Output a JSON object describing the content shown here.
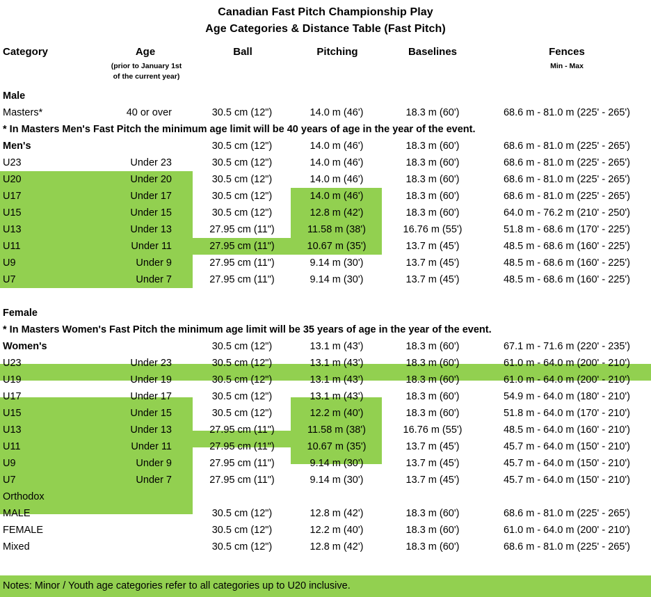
{
  "title": {
    "line1": "Canadian Fast Pitch Championship Play",
    "line2": "Age Categories & Distance Table (Fast Pitch)"
  },
  "headers": {
    "category": "Category",
    "age": "Age",
    "age_sub1": "(prior  to January 1st",
    "age_sub2": "of the current year)",
    "ball": "Ball",
    "pitching": "Pitching",
    "baselines": "Baselines",
    "fences": "Fences",
    "fences_sub": "Min - Max"
  },
  "colors": {
    "highlight": "#92D050",
    "text": "#000000",
    "background": "#FFFFFF"
  },
  "sections": {
    "male_label": "Male",
    "male_note": "* In Masters Men's Fast Pitch the minimum age limit will be 40 years of age in the year of the event.",
    "female_label": "Female",
    "female_note": "* In Masters Women's Fast Pitch the minimum age limit will be 35 years of age in the year of the event.",
    "orthodox_label": "Orthodox"
  },
  "male_rows": [
    {
      "category": "Masters*",
      "age": "40 or over",
      "ball": "30.5 cm (12\")",
      "pitching": "14.0 m (46')",
      "baselines": "18.3 m (60')",
      "fences": "68.6 m - 81.0 m (225' - 265')",
      "bold": false
    },
    {
      "category": "Men's",
      "age": "",
      "ball": "30.5 cm (12\")",
      "pitching": "14.0 m (46')",
      "baselines": "18.3 m (60')",
      "fences": "68.6 m - 81.0 m (225' - 265')",
      "bold": true
    },
    {
      "category": "U23",
      "age": "Under 23",
      "ball": "30.5 cm (12\")",
      "pitching": "14.0 m (46')",
      "baselines": "18.3 m (60')",
      "fences": "68.6 m - 81.0 m (225' - 265')",
      "bold": false
    },
    {
      "category": "U20",
      "age": "Under 20",
      "ball": "30.5 cm (12\")",
      "pitching": "14.0 m (46')",
      "baselines": "18.3 m (60')",
      "fences": "68.6 m - 81.0 m (225' - 265')",
      "bold": false
    },
    {
      "category": "U17",
      "age": "Under 17",
      "ball": "30.5 cm (12\")",
      "pitching": "14.0 m (46')",
      "baselines": "18.3 m (60')",
      "fences": "68.6 m - 81.0 m (225' - 265')",
      "bold": false
    },
    {
      "category": "U15",
      "age": "Under 15",
      "ball": "30.5 cm (12\")",
      "pitching": "12.8 m (42')",
      "baselines": "18.3 m (60')",
      "fences": "64.0 m - 76.2 m (210' - 250')",
      "bold": false
    },
    {
      "category": "U13",
      "age": "Under 13",
      "ball": "27.95 cm (11\")",
      "pitching": "11.58 m (38')",
      "baselines": "16.76 m (55')",
      "fences": "51.8 m - 68.6 m (170' - 225')",
      "bold": false
    },
    {
      "category": "U11",
      "age": "Under 11",
      "ball": "27.95 cm (11\")",
      "pitching": "10.67 m (35')",
      "baselines": "13.7 m (45')",
      "fences": "48.5 m - 68.6 m (160' - 225')",
      "bold": false
    },
    {
      "category": "U9",
      "age": "Under 9",
      "ball": "27.95 cm (11\")",
      "pitching": "9.14 m (30')",
      "baselines": "13.7 m (45')",
      "fences": "48.5 m - 68.6 m (160' - 225')",
      "bold": false
    },
    {
      "category": "U7",
      "age": "Under 7",
      "ball": "27.95 cm (11\")",
      "pitching": "9.14 m (30')",
      "baselines": "13.7 m (45')",
      "fences": "48.5 m - 68.6 m (160' - 225')",
      "bold": false
    }
  ],
  "female_rows": [
    {
      "category": "Women's",
      "age": "",
      "ball": "30.5 cm (12\")",
      "pitching": "13.1 m (43')",
      "baselines": "18.3 m (60')",
      "fences": "67.1 m - 71.6 m (220' - 235')",
      "bold": true
    },
    {
      "category": "U23",
      "age": "Under 23",
      "ball": "30.5 cm (12\")",
      "pitching": "13.1 m (43')",
      "baselines": "18.3 m (60')",
      "fences": "61.0 m - 64.0 m (200' - 210')",
      "bold": false
    },
    {
      "category": "U19",
      "age": "Under 19",
      "ball": "30.5 cm (12\")",
      "pitching": "13.1 m (43')",
      "baselines": "18.3 m (60')",
      "fences": "61.0 m - 64.0 m (200' - 210')",
      "bold": false
    },
    {
      "category": "U17",
      "age": "Under 17",
      "ball": "30.5 cm (12\")",
      "pitching": "13.1 m (43')",
      "baselines": "18.3 m (60')",
      "fences": "54.9 m - 64.0 m (180' - 210')",
      "bold": false
    },
    {
      "category": "U15",
      "age": "Under 15",
      "ball": "30.5 cm (12\")",
      "pitching": "12.2 m (40')",
      "baselines": "18.3 m (60')",
      "fences": "51.8 m - 64.0 m (170' - 210')",
      "bold": false
    },
    {
      "category": "U13",
      "age": "Under 13",
      "ball": "27.95 cm (11\")",
      "pitching": "11.58 m (38')",
      "baselines": "16.76 m (55')",
      "fences": "48.5 m - 64.0 m (160' - 210')",
      "bold": false
    },
    {
      "category": "U11",
      "age": "Under 11",
      "ball": "27.95 cm (11\")",
      "pitching": "10.67 m (35')",
      "baselines": "13.7 m (45')",
      "fences": "45.7 m - 64.0 m (150' - 210')",
      "bold": false
    },
    {
      "category": "U9",
      "age": "Under 9",
      "ball": "27.95 cm (11\")",
      "pitching": "9.14 m (30')",
      "baselines": "13.7 m (45')",
      "fences": "45.7 m - 64.0 m (150' - 210')",
      "bold": false
    },
    {
      "category": "U7",
      "age": "Under 7",
      "ball": "27.95 cm (11\")",
      "pitching": "9.14 m (30')",
      "baselines": "13.7 m (45')",
      "fences": "45.7 m - 64.0 m (150' - 210')",
      "bold": false
    }
  ],
  "orthodox_rows": [
    {
      "category": "MALE",
      "age": "",
      "ball": "30.5 cm (12\")",
      "pitching": "12.8 m (42')",
      "baselines": "18.3 m (60')",
      "fences": "68.6 m - 81.0 m (225' - 265')",
      "bold": false
    },
    {
      "category": "FEMALE",
      "age": "",
      "ball": "30.5 cm (12\")",
      "pitching": "12.2 m (40')",
      "baselines": "18.3 m (60')",
      "fences": "61.0 m - 64.0 m (200' - 210')",
      "bold": false
    },
    {
      "category": "Mixed",
      "age": "",
      "ball": "30.5 cm (12\")",
      "pitching": "12.8 m (42')",
      "baselines": "18.3 m (60')",
      "fences": "68.6 m - 81.0 m (225' - 265')",
      "bold": false
    }
  ],
  "footer": {
    "notes": "Notes: Minor / Youth age categories refer to all categories up to U20 inclusive."
  }
}
